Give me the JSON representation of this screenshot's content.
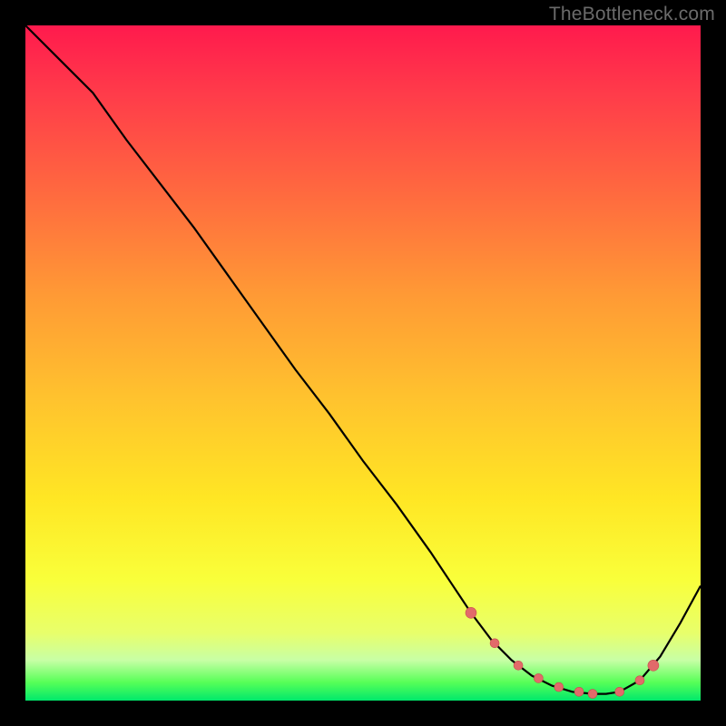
{
  "watermark": "TheBottleneck.com",
  "chart_data": {
    "type": "line",
    "title": "",
    "xlabel": "",
    "ylabel": "",
    "xlim": [
      0,
      100
    ],
    "ylim": [
      0,
      100
    ],
    "grid": false,
    "legend": false,
    "series": [
      {
        "name": "curve",
        "x": [
          0,
          5,
          10,
          15,
          20,
          25,
          30,
          35,
          40,
          45,
          50,
          55,
          60,
          63,
          66,
          69,
          72,
          75,
          78,
          81,
          84,
          86,
          88,
          91,
          94,
          97,
          100
        ],
        "y": [
          100,
          95,
          90,
          83,
          76.5,
          70,
          63,
          56,
          49,
          42.5,
          35.5,
          29,
          22,
          17.5,
          13,
          9,
          6,
          3.7,
          2.2,
          1.3,
          1,
          1,
          1.3,
          3,
          6.5,
          11.5,
          17
        ]
      }
    ],
    "markers": {
      "name": "highlight-dots",
      "x": [
        66,
        69.5,
        73,
        76,
        79,
        82,
        84,
        88,
        91,
        93
      ],
      "y": [
        13,
        8.5,
        5.2,
        3.3,
        2,
        1.3,
        1,
        1.3,
        3,
        5.2
      ]
    },
    "colors": {
      "line": "#000000",
      "marker": "#e26a6a",
      "gradient_top": "#ff1a4d",
      "gradient_bottom": "#00e86b"
    }
  }
}
